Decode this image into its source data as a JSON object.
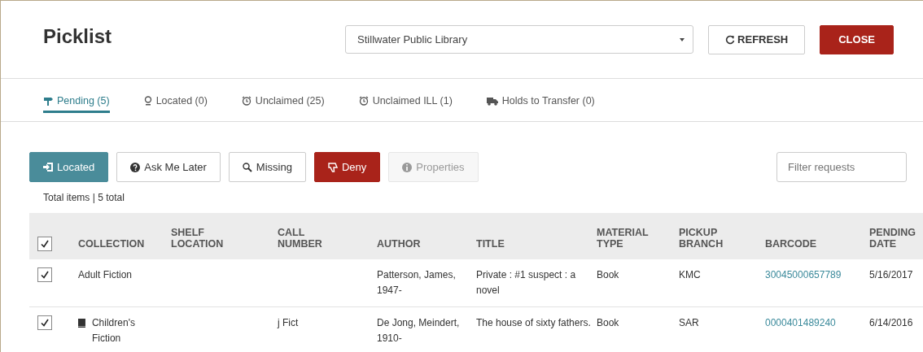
{
  "header": {
    "title": "Picklist",
    "branch_select": {
      "value": "Stillwater Public Library"
    },
    "buttons": [
      {
        "label": "REFRESH",
        "kind": "default"
      },
      {
        "label": "CLOSE",
        "kind": "danger"
      }
    ]
  },
  "tabs": [
    {
      "label": "Pending (5)",
      "selected": true
    },
    {
      "label": "Located (0)",
      "selected": false
    },
    {
      "label": "Unclaimed (25)",
      "selected": false
    },
    {
      "label": "Unclaimed ILL (1)",
      "selected": false
    },
    {
      "label": "Holds to Transfer (0)",
      "selected": false
    }
  ],
  "toolbar": {
    "buttons": [
      {
        "label": "Located",
        "kind": "primary",
        "disabled": false
      },
      {
        "label": "Ask Me Later",
        "kind": "default",
        "disabled": false
      },
      {
        "label": "Missing",
        "kind": "default",
        "disabled": false
      },
      {
        "label": "Deny",
        "kind": "danger",
        "disabled": false
      },
      {
        "label": "Properties",
        "kind": "default",
        "disabled": true
      }
    ],
    "filter": {
      "placeholder": "Filter requests"
    }
  },
  "total_items": "Total items | 5 total",
  "table": {
    "select_all_checked": true,
    "columns": [
      "COLLECTION",
      "SHELF LOCATION",
      "CALL NUMBER",
      "AUTHOR",
      "TITLE",
      "MATERIAL TYPE",
      "PICKUP BRANCH",
      "BARCODE",
      "PENDING DATE"
    ],
    "rows": [
      {
        "checked": true,
        "kind": "plain",
        "cells": [
          "Adult Fiction",
          "",
          "",
          "Patterson, James, 1947-",
          "Private : #1 suspect : a novel",
          "Book",
          "KMC",
          "30045000657789",
          "5/16/2017"
        ]
      },
      {
        "checked": true,
        "kind": "book",
        "cells": [
          "Children's Fiction",
          "",
          "j Fict",
          "De Jong, Meindert, 1910-",
          "The house of sixty fathers.",
          "Book",
          "SAR",
          "0000401489240",
          "6/14/2016"
        ]
      }
    ]
  }
}
